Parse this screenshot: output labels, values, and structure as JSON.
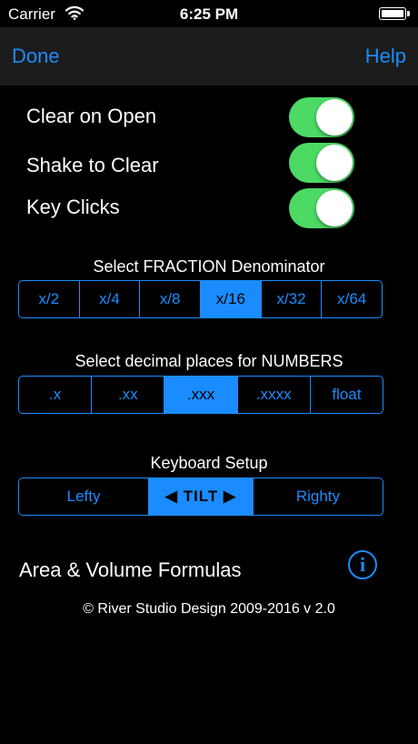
{
  "status": {
    "carrier": "Carrier",
    "time": "6:25 PM"
  },
  "nav": {
    "done": "Done",
    "help": "Help"
  },
  "settings": [
    {
      "label": "Clear on Open",
      "on": true
    },
    {
      "label": "Shake to Clear",
      "on": true
    },
    {
      "label": "Key Clicks",
      "on": true
    }
  ],
  "fraction": {
    "title": "Select FRACTION Denominator",
    "options": [
      "x/2",
      "x/4",
      "x/8",
      "x/16",
      "x/32",
      "x/64"
    ],
    "selected": "x/16"
  },
  "decimal": {
    "title": "Select decimal places for NUMBERS",
    "options": [
      ".x",
      ".xx",
      ".xxx",
      ".xxxx",
      "float"
    ],
    "selected": ".xxx"
  },
  "keyboard": {
    "title": "Keyboard Setup",
    "options": [
      "Lefty",
      "◀ TILT ▶",
      "Righty"
    ],
    "selected": "◀ TILT ▶"
  },
  "area": {
    "label": "Area & Volume Formulas",
    "info_icon": "info-icon"
  },
  "footer": {
    "copyright": "© River Studio Design 2009-2016  v 2.0"
  },
  "colors": {
    "accent": "#1a8cff",
    "toggle_on": "#4cd964",
    "background": "#000000",
    "navbar": "#1c1c1c"
  }
}
